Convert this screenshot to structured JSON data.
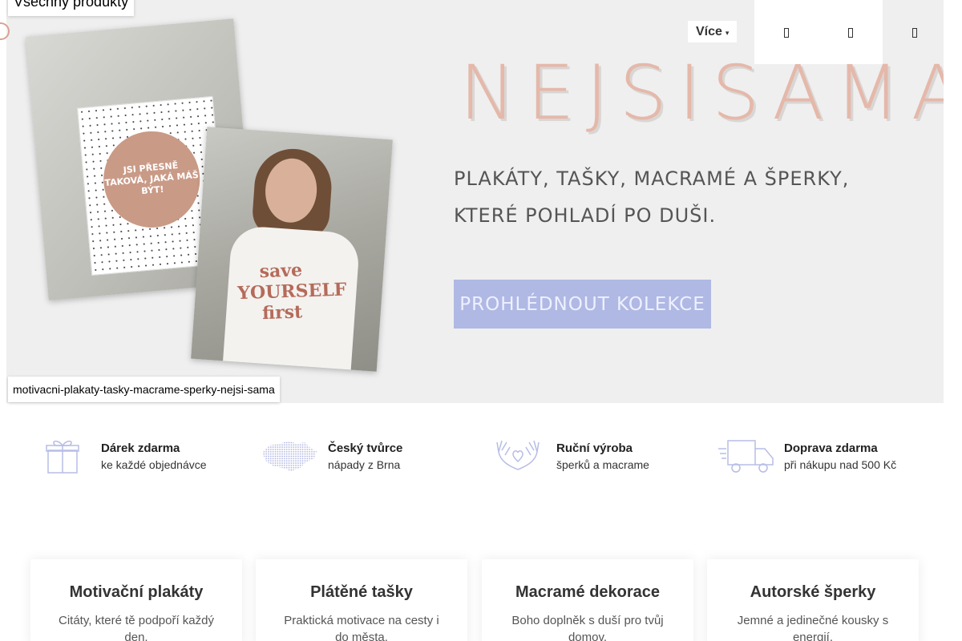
{
  "nav": {
    "all_products": "Všechny produkty",
    "more": "Více",
    "more_caret": "▾"
  },
  "hero": {
    "brand": "NEJSISAMA",
    "tagline_line1": "PLAKÁTY, TAŠKY, MACRAMÉ A ŠPERKY,",
    "tagline_line2": "KTERÉ POHLADÍ PO DUŠI.",
    "cta": "PROHLÉDNOUT KOLEKCE",
    "image_alt": "motivacni-plakaty-tasky-macrame-sperky-nejsi-sama",
    "poster_text": "JSI PŘESNĚ TAKOVÁ, JAKÁ MÁŠ BÝT!",
    "shirt_text": "save YOURSELF first",
    "colors": {
      "brand": "#e5b8aa",
      "cta_bg": "#b0b9e4",
      "hero_bg": "#efefef"
    }
  },
  "features": [
    {
      "icon": "gift-icon",
      "title": "Dárek zdarma",
      "subtitle": "ke každé objednávce"
    },
    {
      "icon": "czech-map-icon",
      "title": "Český tvůrce",
      "subtitle": "nápady z Brna"
    },
    {
      "icon": "hands-heart-icon",
      "title": "Ruční výroba",
      "subtitle": "šperků a macrame"
    },
    {
      "icon": "truck-icon",
      "title": "Doprava zdarma",
      "subtitle": "při nákupu nad 500 Kč"
    }
  ],
  "categories": [
    {
      "title": "Motivační plakáty",
      "description": "Citáty, které tě podpoří každý den."
    },
    {
      "title": "Plátěné tašky",
      "description": "Praktická motivace na cesty i do města."
    },
    {
      "title": "Macramé dekorace",
      "description": "Boho doplněk s duší pro tvůj domov."
    },
    {
      "title": "Autorské šperky",
      "description": "Jemné a jedinečné kousky s energií."
    }
  ]
}
